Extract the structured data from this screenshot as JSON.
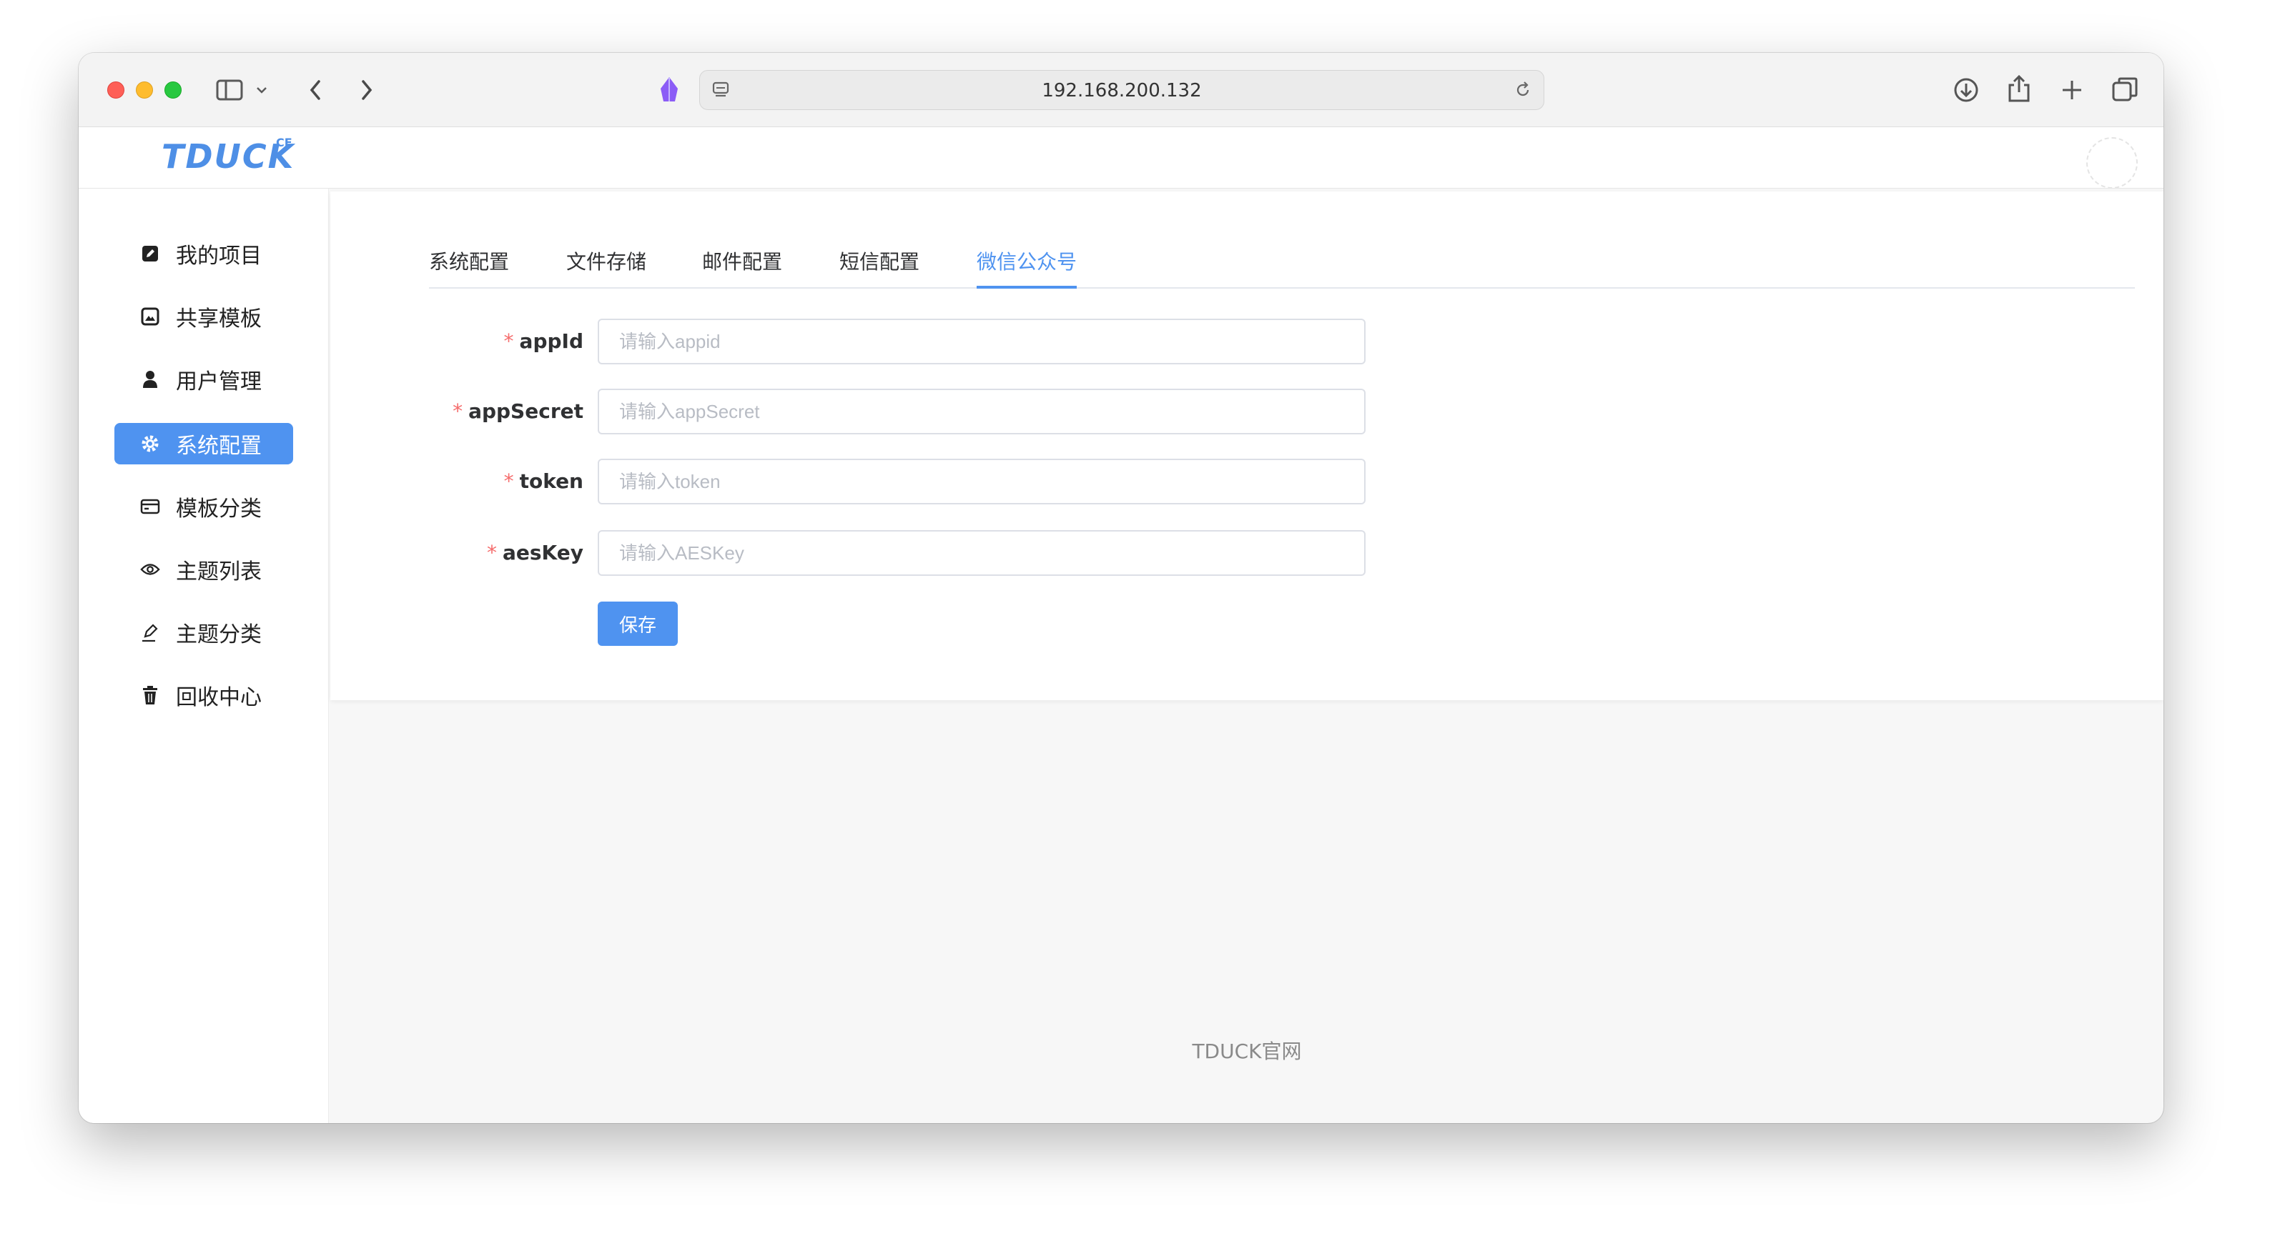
{
  "browser": {
    "url": "192.168.200.132"
  },
  "app": {
    "logo": "TDUCK",
    "logo_sup": "CE"
  },
  "sidebar": {
    "items": [
      {
        "label": "我的项目",
        "icon": "edit-square-icon",
        "active": false
      },
      {
        "label": "共享模板",
        "icon": "image-box-icon",
        "active": false
      },
      {
        "label": "用户管理",
        "icon": "user-icon",
        "active": false
      },
      {
        "label": "系统配置",
        "icon": "gear-icon",
        "active": true
      },
      {
        "label": "模板分类",
        "icon": "card-icon",
        "active": false
      },
      {
        "label": "主题列表",
        "icon": "eye-icon",
        "active": false
      },
      {
        "label": "主题分类",
        "icon": "pen-icon",
        "active": false
      },
      {
        "label": "回收中心",
        "icon": "trash-icon",
        "active": false
      }
    ]
  },
  "tabs": [
    {
      "label": "系统配置",
      "active": false
    },
    {
      "label": "文件存储",
      "active": false
    },
    {
      "label": "邮件配置",
      "active": false
    },
    {
      "label": "短信配置",
      "active": false
    },
    {
      "label": "微信公众号",
      "active": true
    }
  ],
  "form": {
    "fields": [
      {
        "label": "appId",
        "placeholder": "请输入appid",
        "value": "",
        "required": true
      },
      {
        "label": "appSecret",
        "placeholder": "请输入appSecret",
        "value": "",
        "required": true
      },
      {
        "label": "token",
        "placeholder": "请输入token",
        "value": "",
        "required": true
      },
      {
        "label": "aesKey",
        "placeholder": "请输入AESKey",
        "value": "",
        "required": true
      }
    ],
    "required_mark": "*",
    "save_label": "保存"
  },
  "footer": {
    "link": "TDUCK官网"
  },
  "colors": {
    "accent": "#4f93f0",
    "required": "#f56c6c"
  }
}
